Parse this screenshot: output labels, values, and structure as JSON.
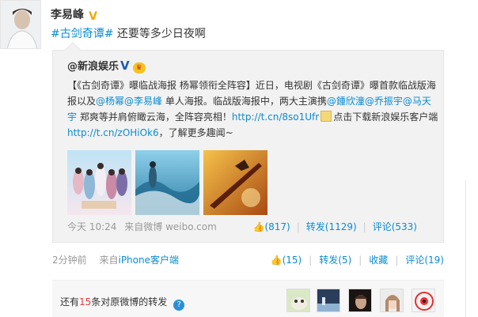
{
  "post": {
    "author": "李易峰",
    "verified_badge": "V",
    "topic": "#古剑奇谭#",
    "text": " 还要等多少日夜啊",
    "time": "2分钟前",
    "source_prefix": "来自",
    "source": "iPhone客户端",
    "actions": {
      "likes": "(15)",
      "repost": "转发(5)",
      "favorite": "收藏",
      "comment": "评论(19)"
    }
  },
  "quoted": {
    "author": "@新浪娱乐",
    "verified_badge": "V",
    "text_parts": [
      "【《古剑奇谭》曝临战海报 杨幂领衔全阵容】近日，电视剧《古剑奇谭》曝首款临战版海报以及",
      "@杨幂",
      "@李易峰",
      " 单人海报。临战版海报中，两大主演携",
      "@鍾欣潼",
      "@乔振宇",
      "@马天宇",
      " 郑爽等并肩俯瞰云海，全阵容亮相！",
      "http://t.cn/8so1Ufr",
      "点击下载新浪娱乐客户端",
      "http://t.cn/zOHiOk6",
      "，了解更多趣闻~"
    ],
    "time": "今天 10:24",
    "source_prefix": "来自",
    "source": "微博 weibo.com",
    "actions": {
      "likes": "(817)",
      "repost": "转发(1129)",
      "comment": "评论(533)"
    }
  },
  "repost_bar": {
    "prefix": "还有",
    "count": "15",
    "suffix": "条对原微博的转发",
    "help": "?"
  },
  "colors": {
    "link": "#0a8cd2",
    "accent_red": "#e4393c",
    "quote_bg": "#f2f2f2"
  }
}
